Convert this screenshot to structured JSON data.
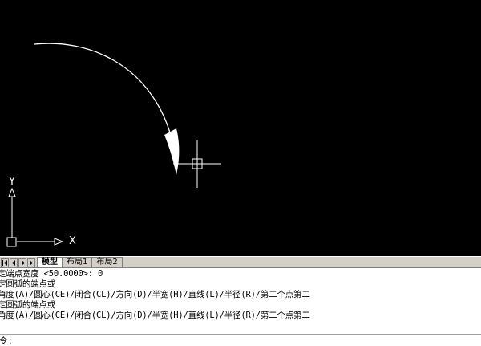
{
  "canvas": {
    "background": "#000000",
    "ucs": {
      "x_label": "X",
      "y_label": "Y"
    },
    "cursor_icon": "crosshair-pickbox-icon",
    "arc_color": "#ffffff"
  },
  "tabs": {
    "nav_icons": [
      "first-tab-icon",
      "prev-tab-icon",
      "next-tab-icon",
      "last-tab-icon"
    ],
    "items": [
      {
        "label": "模型",
        "active": true
      },
      {
        "label": "布局1",
        "active": false
      },
      {
        "label": "布局2",
        "active": false
      }
    ]
  },
  "command": {
    "history": [
      "定端点宽度 <50.0000>: 0",
      "定圆弧的端点或",
      "角度(A)/圆心(CE)/闭合(CL)/方向(D)/半宽(H)/直线(L)/半径(R)/第二个点第二",
      "定圆弧的端点或",
      "角度(A)/圆心(CE)/闭合(CL)/方向(D)/半宽(H)/直线(L)/半径(R)/第二个点第二"
    ],
    "prompt": "令:",
    "input_value": ""
  }
}
